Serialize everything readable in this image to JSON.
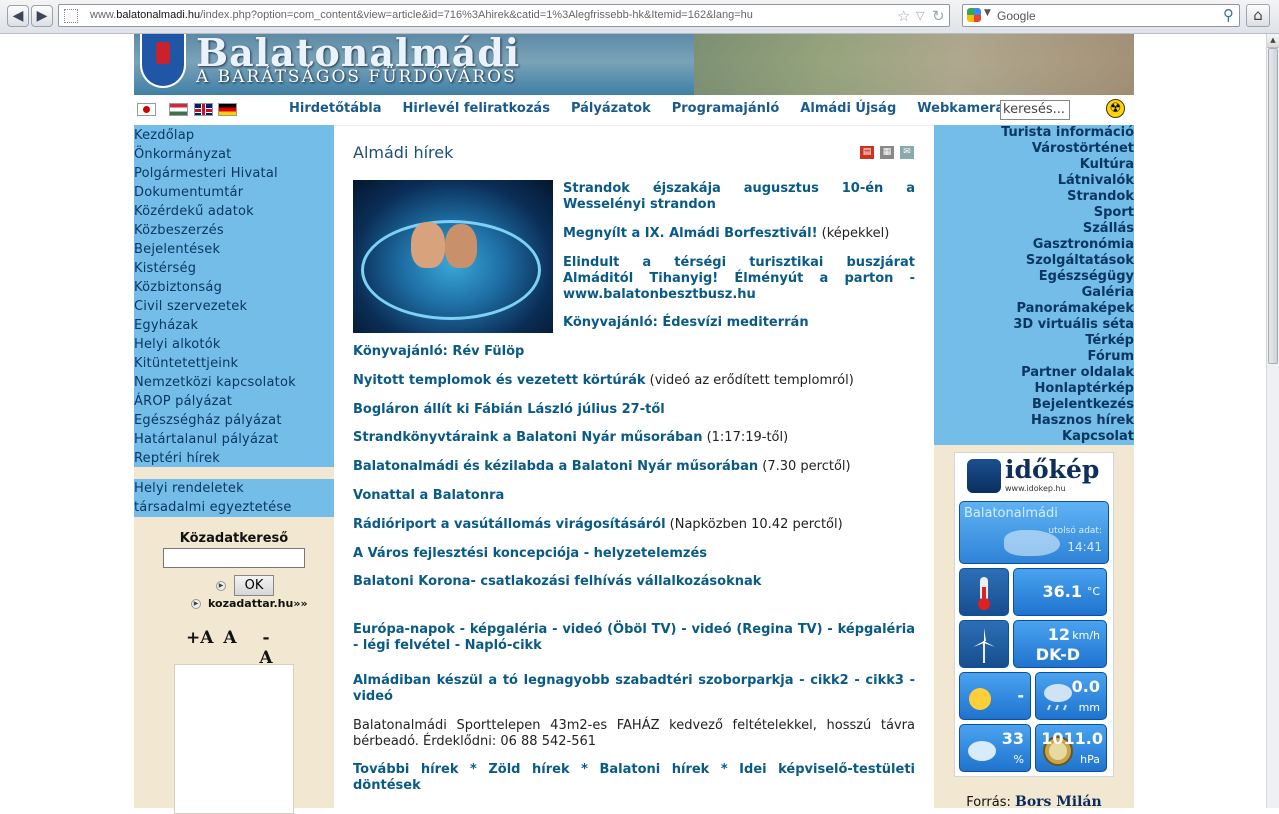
{
  "browser": {
    "url_pre": "www.",
    "url_host": "balatonalmadi.hu",
    "url_rest": "/index.php?option=com_content&view=article&id=716%3Ahirek&catid=1%3Alegfrissebb-hk&Itemid=162&lang=hu",
    "search_placeholder": "Google"
  },
  "banner": {
    "title": "Balatonalmádi",
    "subtitle": "A BARÁTSÁGOS FÜRDŐVÁROS"
  },
  "topnav": {
    "links": [
      "Hirdetőtábla",
      "Hirlevél feliratkozás",
      "Pályázatok",
      "Programajánló",
      "Almádi Újság",
      "Webkamera"
    ],
    "search_value": "keresés..."
  },
  "leftnav": [
    "Kezdőlap",
    "Önkormányzat",
    "Polgármesteri Hivatal",
    "Dokumentumtár",
    "Közérdekű adatok",
    "Közbeszerzés",
    "Bejelentések",
    "Kistérség",
    "Közbiztonság",
    "Civil szervezetek",
    "Egyházak",
    "Helyi alkotók",
    "Kitüntetettjeink",
    "Nemzetközi kapcsolatok",
    "ÁROP pályázat",
    "Egészségház pályázat",
    "Határtalanul pályázat",
    "Reptéri hírek"
  ],
  "leftnav2": [
    "Helyi rendeletek",
    "társadalmi egyeztetése"
  ],
  "kozadat": {
    "label": "Közadatkereső",
    "ok": "OK",
    "link": "kozadattar.hu»»"
  },
  "fontsize": [
    "+A",
    "A",
    "-A"
  ],
  "main": {
    "title": "Almádi hírek",
    "items": [
      {
        "link": "Strandok éjszakája augusztus 10-én a Wesselényi strandon",
        "extra": ""
      },
      {
        "link": "Megnyílt a IX. Almádi Borfesztivál!",
        "extra": " (képekkel)"
      },
      {
        "link": "Elindult a térségi turisztikai buszjárat Almáditól Tihanyig! Élményút a parton - www.balatonbesztbusz.hu",
        "extra": ""
      },
      {
        "link": "Könyvajánló: Édesvízi mediterrán",
        "extra": ""
      },
      {
        "link": "Könyvajánló: Rév Fülöp",
        "extra": ""
      },
      {
        "link": "Nyitott templomok és vezetett körtúrák",
        "extra": " (videó az erődített templomról)"
      },
      {
        "link": "Bogláron állít ki Fábián László július 27-től",
        "extra": ""
      },
      {
        "link": "Strandkönyvtáraink a Balatoni Nyár műsorában",
        "extra": " (1:17:19-től)"
      },
      {
        "link": "Balatonalmádi és kézilabda a Balatoni Nyár műsorában",
        "extra": " (7.30 perctől)"
      },
      {
        "link": "Vonattal a Balatonra",
        "extra": ""
      },
      {
        "link": "Rádióriport a vasútállomás virágosításáról",
        "extra": " (Napközben 10.42 perctől)"
      },
      {
        "link": "A Város fejlesztési koncepciója - helyzetelemzés",
        "extra": ""
      },
      {
        "link": "Balatoni Korona- csatlakozási felhívás vállalkozásoknak",
        "extra": ""
      },
      {
        "link": "Európa-napok  - képgaléria - videó (Öböl TV) - videó (Regina TV) - képgaléria - légi felvétel - Napló-cikk",
        "extra": ""
      },
      {
        "link": "Almádiban készül a tó legnagyobb szabadtéri szoborparkja - cikk2 - cikk3 - videó",
        "extra": ""
      },
      {
        "link": "",
        "extra": "Balatonalmádi Sporttelepen 43m2-es FAHÁZ kedvező feltételekkel, hosszú távra bérbeadó. Érdeklődni: 06 88 542-561"
      },
      {
        "link": "További hírek * Zöld hírek * Balatoni hírek * Idei képviselő-testületi döntések",
        "extra": ""
      }
    ]
  },
  "rightnav": [
    "Turista információ",
    "Várostörténet",
    "Kultúra",
    "Látnivalók",
    "Strandok",
    "Sport",
    "Szállás",
    "Gasztronómia",
    "Szolgáltatások",
    "Egészségügy",
    "Galéria",
    "Panorámaképek",
    "3D virtuális séta",
    "Térkép",
    "Fórum",
    "Partner oldalak",
    "Honlaptérkép",
    "Bejelentkezés",
    "Hasznos hírek",
    "Kapcsolat"
  ],
  "weather": {
    "logo": "időkép",
    "logo_sub": "www.idokep.hu",
    "city": "Balatonalmádi",
    "updated_label": "utolsó adat:",
    "time": "14:41",
    "temp": "36.1",
    "temp_unit": "°C",
    "wind_speed": "12",
    "wind_unit": "km/h",
    "wind_dir": "DK-D",
    "sun": "-",
    "rain": "0.0",
    "rain_unit": "mm",
    "humidity": "33",
    "humidity_unit": "%",
    "pressure": "1011.0",
    "pressure_unit": "hPa"
  },
  "source": {
    "label": "Forrás:",
    "name": "Bors Milán"
  },
  "colors": {
    "nav_blue": "#74bde8",
    "link_blue": "#0a5a86",
    "beige": "#f2e8d2"
  }
}
